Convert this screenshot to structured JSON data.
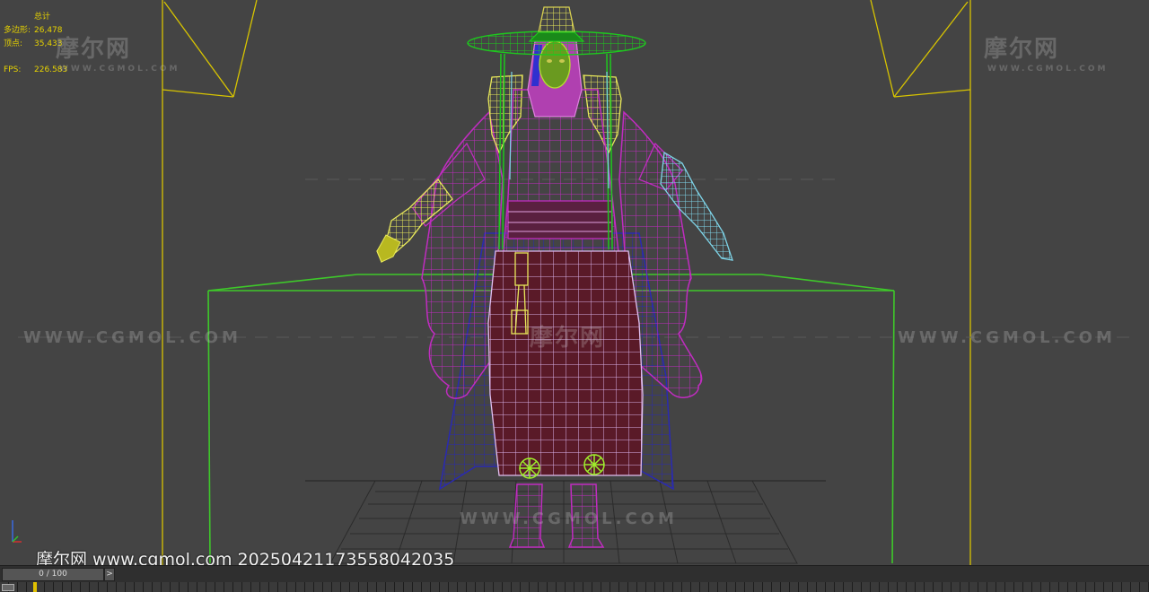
{
  "stats": {
    "header": "总计",
    "polygons_label": "多边形:",
    "polygons_value": "26,478",
    "vertices_label": "顶点:",
    "vertices_value": "35,433",
    "fps_label": "FPS:",
    "fps_value": "226.583"
  },
  "watermarks": {
    "logo": "摩尔网",
    "logo_url": "WWW.CGMOL.COM",
    "url": "WWW.CGMOL.COM"
  },
  "credit": "摩尔网 www.cgmol.com 20250421173558042035",
  "timeline": {
    "frame_display": "0 / 100",
    "next_label": ">"
  },
  "colors": {
    "viewport_bg": "#444444",
    "stats_text": "#e6d200",
    "camera_lines": "#d8c400",
    "bounding_box": "#3ec82a",
    "robe_wire": "#c02cc0",
    "lining_wire": "#2a2ab0",
    "hat_wire": "#1ec81e",
    "glove_left_wire": "#e8e85a",
    "glove_right_wire": "#7ed4e8"
  }
}
